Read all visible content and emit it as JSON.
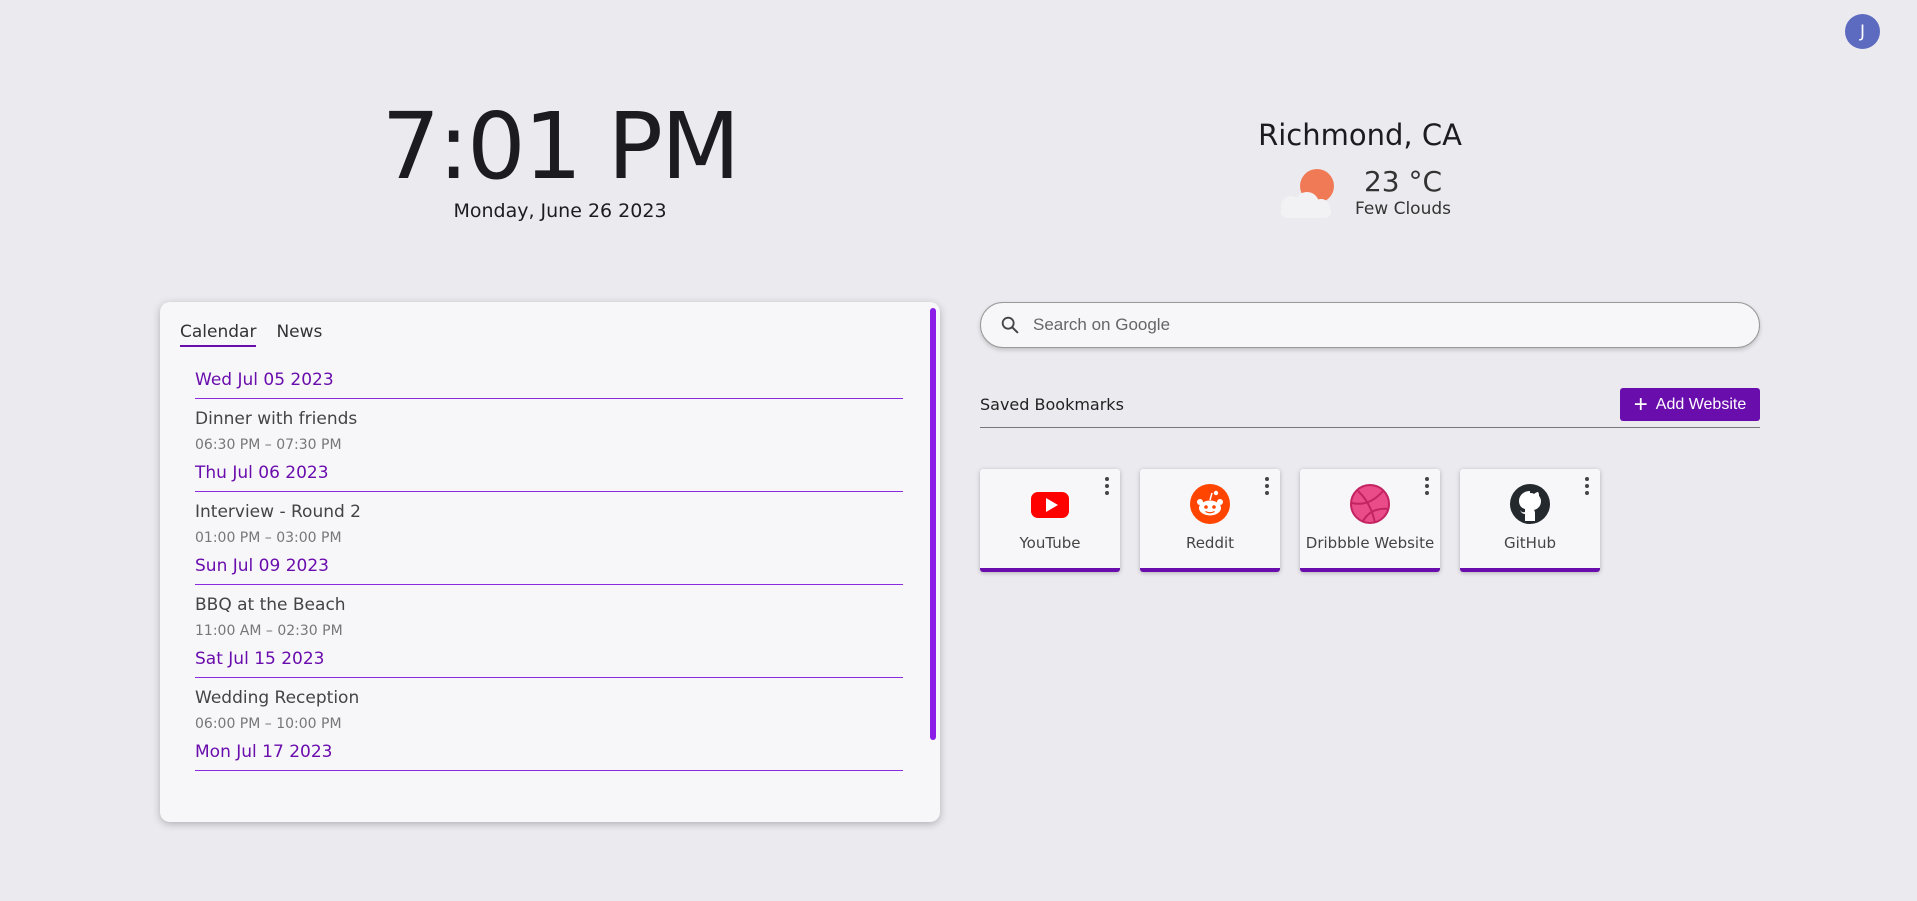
{
  "user": {
    "avatar_initial": "J"
  },
  "clock": {
    "time": "7:01 PM",
    "date": "Monday, June 26 2023"
  },
  "weather": {
    "city": "Richmond, CA",
    "temperature": "23 °C",
    "description": "Few Clouds",
    "icon": "partly-cloudy-icon"
  },
  "panel": {
    "tabs": [
      {
        "label": "Calendar",
        "active": true
      },
      {
        "label": "News",
        "active": false
      }
    ],
    "days": [
      {
        "date": "Wed Jul 05 2023",
        "title": "Dinner with friends",
        "time": "06:30 PM – 07:30 PM"
      },
      {
        "date": "Thu Jul 06 2023",
        "title": "Interview - Round 2",
        "time": "01:00 PM – 03:00 PM"
      },
      {
        "date": "Sun Jul 09 2023",
        "title": "BBQ at the Beach",
        "time": "11:00 AM – 02:30 PM"
      },
      {
        "date": "Sat Jul 15 2023",
        "title": "Wedding Reception",
        "time": "06:00 PM – 10:00 PM"
      },
      {
        "date": "Mon Jul 17 2023"
      }
    ]
  },
  "search": {
    "placeholder": "Search on Google"
  },
  "bookmarks": {
    "title": "Saved Bookmarks",
    "add_label": "Add Website",
    "items": [
      {
        "label": "YouTube",
        "icon": "youtube-icon",
        "color": "#ff0000"
      },
      {
        "label": "Reddit",
        "icon": "reddit-icon",
        "color": "#ff4500"
      },
      {
        "label": "Dribbble Website",
        "icon": "dribbble-icon",
        "color": "#ea4c89"
      },
      {
        "label": "GitHub",
        "icon": "github-icon",
        "color": "#24292e"
      }
    ]
  },
  "colors": {
    "accent": "#6a0dad",
    "background": "#ebeaef",
    "avatar": "#5c6bc0"
  }
}
